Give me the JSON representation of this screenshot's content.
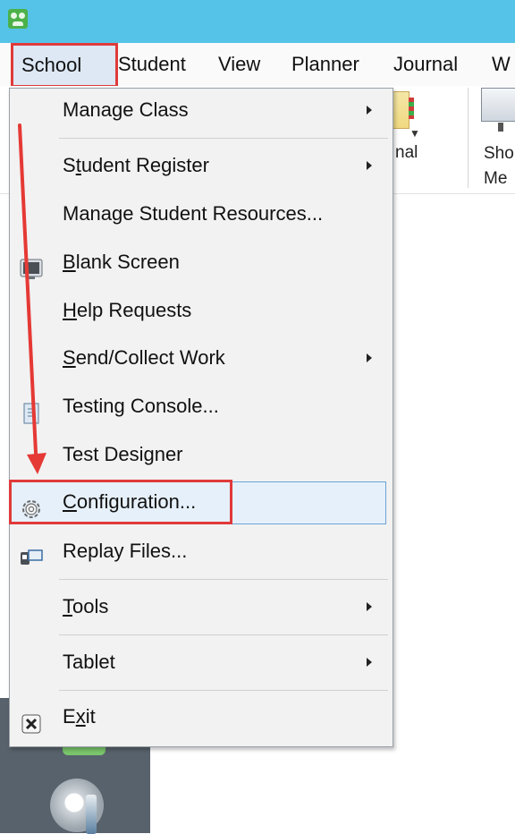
{
  "menubar": {
    "items": [
      "School",
      "Student",
      "View",
      "Planner",
      "Journal",
      "W"
    ]
  },
  "ribbon": {
    "journal_label": "nal",
    "show_label_line1": "Sho",
    "show_label_line2": "Me"
  },
  "menu": {
    "items": [
      {
        "label_pre": "Manage Class",
        "label_u": "",
        "label_post": "",
        "submenu": true
      },
      {
        "label_pre": "S",
        "label_u": "t",
        "label_post": "udent Register",
        "submenu": true
      },
      {
        "label_pre": "Manage Student Resources...",
        "label_u": "",
        "label_post": "",
        "submenu": false
      },
      {
        "label_pre": "",
        "label_u": "B",
        "label_post": "lank Screen",
        "submenu": false
      },
      {
        "label_pre": "",
        "label_u": "H",
        "label_post": "elp Requests",
        "submenu": false
      },
      {
        "label_pre": "",
        "label_u": "S",
        "label_post": "end/Collect Work",
        "submenu": true
      },
      {
        "label_pre": "Testing Console...",
        "label_u": "",
        "label_post": "",
        "submenu": false
      },
      {
        "label_pre": "Test Designer",
        "label_u": "",
        "label_post": "",
        "submenu": false
      },
      {
        "label_pre": "",
        "label_u": "C",
        "label_post": "onfiguration...",
        "submenu": false
      },
      {
        "label_pre": "Replay Files...",
        "label_u": "",
        "label_post": "",
        "submenu": false
      },
      {
        "label_pre": "",
        "label_u": "T",
        "label_post": "ools",
        "submenu": true
      },
      {
        "label_pre": "Tablet",
        "label_u": "",
        "label_post": "",
        "submenu": true
      },
      {
        "label_pre": "E",
        "label_u": "x",
        "label_post": "it",
        "submenu": false
      }
    ]
  },
  "colors": {
    "titlebar": "#55c3e8",
    "highlight_box": "#e03a3a",
    "selected_item": "#e6f0fa"
  }
}
